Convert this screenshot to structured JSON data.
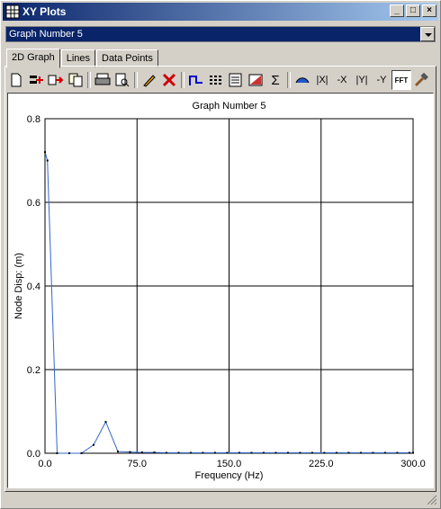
{
  "window": {
    "title": "XY Plots",
    "minimize": "_",
    "maximize": "□",
    "close": "×"
  },
  "selector": {
    "value": "Graph Number 5"
  },
  "tabs": [
    {
      "label": "2D Graph"
    },
    {
      "label": "Lines"
    },
    {
      "label": "Data Points"
    }
  ],
  "toolbar": {
    "items": [
      "new-icon",
      "add-line-icon",
      "export-icon",
      "copy-icon",
      "print-icon",
      "print-preview-icon",
      "edit-icon",
      "delete-icon",
      "curve-icon",
      "grid-icon",
      "list-icon",
      "fill-icon",
      "sum-icon",
      "overlay-icon",
      "abs-x",
      "neg-x",
      "abs-y",
      "neg-y",
      "fft",
      "hammer-icon"
    ],
    "abs_x": "|X|",
    "neg_x": "-X",
    "abs_y": "|Y|",
    "neg_y": "-Y",
    "fft": "FFT",
    "sum": "Σ"
  },
  "chart_data": {
    "type": "line",
    "title": "Graph Number 5",
    "xlabel": "Frequency (Hz)",
    "ylabel": "Node Disp: (m)",
    "xlim": [
      0,
      300
    ],
    "ylim": [
      0,
      0.8
    ],
    "xticks": [
      "0.0",
      "75.0",
      "150.0",
      "225.0",
      "300.0"
    ],
    "yticks": [
      "0.0",
      "0.2",
      "0.4",
      "0.6",
      "0.8"
    ],
    "grid": true,
    "color": "#3366cc",
    "series": [
      {
        "x": [
          0,
          2,
          9.9,
          19.8,
          29.7,
          39.6,
          49.5,
          59.4,
          69.3,
          79.2,
          89.1,
          99,
          108.9,
          118.8,
          128.7,
          138.6,
          148.5,
          158.4,
          168.3,
          178.2,
          188.1,
          198,
          207.9,
          217.8,
          227.7,
          237.6,
          247.5,
          257.4,
          267.3,
          277.2,
          287.1,
          297,
          300
        ],
        "values": [
          0.72,
          0.7,
          0.0,
          0.0,
          0.0,
          0.02,
          0.075,
          0.004,
          0.003,
          0.002,
          0.002,
          0.001,
          0.001,
          0.001,
          0.001,
          0.001,
          0.001,
          0.001,
          0.001,
          0.001,
          0.001,
          0.001,
          0.001,
          0.001,
          0.001,
          0.001,
          0.001,
          0.001,
          0.001,
          0.001,
          0.001,
          0.001,
          0.001
        ]
      }
    ]
  }
}
